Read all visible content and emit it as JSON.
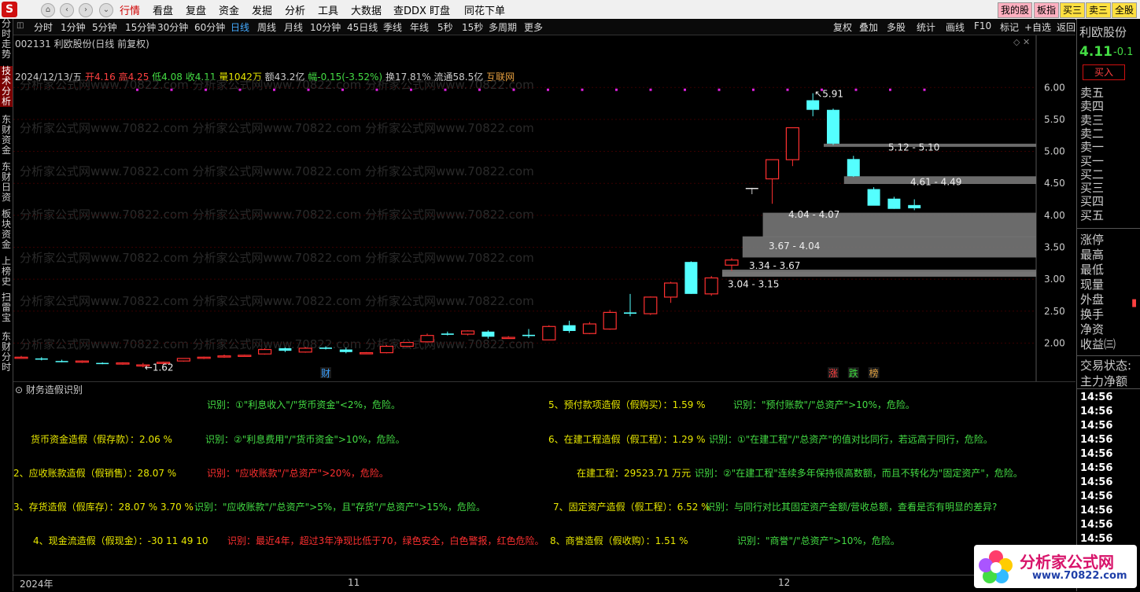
{
  "app": {
    "menus": [
      "行情",
      "看盘",
      "复盘",
      "资金",
      "发掘",
      "分析",
      "工具",
      "大数据",
      "查DDX",
      "盯盘",
      "同花下单"
    ],
    "active_menu": "行情",
    "right_buttons": [
      "我的股",
      "板指",
      "买三",
      "卖三",
      "全股"
    ]
  },
  "sidebar": {
    "tabs": [
      "分时走势",
      "技术分析",
      "东财资金",
      "东财日资",
      "板块资金",
      "上榜史",
      "扫雷宝",
      "东财分时"
    ],
    "active": "技术分析"
  },
  "period_bar": {
    "tabs": [
      "分时",
      "1分钟",
      "5分钟",
      "15分钟",
      "30分钟",
      "60分钟",
      "日线",
      "周线",
      "月线",
      "10分钟",
      "45日线",
      "季线",
      "年线",
      "5秒",
      "15秒",
      "多周期",
      "更多"
    ],
    "active": "日线",
    "tools": [
      "复权",
      "叠加",
      "多股",
      "统计",
      "画线",
      "F10",
      "标记",
      "+自选",
      "返回"
    ]
  },
  "stock": {
    "title": "002131 利欧股份(日线 前复权)",
    "date": "2024/12/13/五",
    "open": "开4.16",
    "high": "高4.25",
    "low": "低4.08",
    "close": "收4.11",
    "volume": "量1042万",
    "amount": "额43.2亿",
    "change": "幅-0.15(-3.52%)",
    "turnover": "换17.81%",
    "float_cap": "流通58.5亿",
    "concept": "互联网"
  },
  "watermark": "分析家公式网www.70822.com",
  "chart_data": {
    "type": "candlestick",
    "y_ticks": [
      "6.00",
      "5.50",
      "5.00",
      "4.50",
      "4.00",
      "3.50",
      "3.00",
      "2.50",
      "2.00"
    ],
    "ylim": [
      1.55,
      6.2
    ],
    "high_label": "5.91",
    "low_label": "1.62",
    "candles": [
      [
        1.78,
        1.8,
        1.76,
        1.78
      ],
      [
        1.76,
        1.78,
        1.73,
        1.75
      ],
      [
        1.72,
        1.74,
        1.7,
        1.71
      ],
      [
        1.71,
        1.73,
        1.69,
        1.72
      ],
      [
        1.69,
        1.7,
        1.67,
        1.68
      ],
      [
        1.68,
        1.7,
        1.66,
        1.69
      ],
      [
        1.66,
        1.69,
        1.62,
        1.66
      ],
      [
        1.69,
        1.71,
        1.67,
        1.7
      ],
      [
        1.72,
        1.76,
        1.71,
        1.76
      ],
      [
        1.77,
        1.79,
        1.75,
        1.78
      ],
      [
        1.79,
        1.82,
        1.77,
        1.8
      ],
      [
        1.8,
        1.82,
        1.79,
        1.81
      ],
      [
        1.83,
        1.92,
        1.82,
        1.9
      ],
      [
        1.92,
        1.93,
        1.86,
        1.88
      ],
      [
        1.86,
        1.94,
        1.85,
        1.92
      ],
      [
        1.93,
        1.95,
        1.9,
        1.91
      ],
      [
        1.9,
        1.93,
        1.84,
        1.86
      ],
      [
        1.84,
        1.86,
        1.83,
        1.85
      ],
      [
        1.85,
        1.97,
        1.84,
        1.95
      ],
      [
        1.95,
        2.02,
        1.94,
        2.01
      ],
      [
        2.02,
        2.15,
        2.01,
        2.12
      ],
      [
        2.15,
        2.18,
        2.12,
        2.13
      ],
      [
        2.14,
        2.2,
        2.12,
        2.19
      ],
      [
        2.18,
        2.2,
        2.07,
        2.1
      ],
      [
        2.09,
        2.11,
        2.07,
        2.09
      ],
      [
        2.13,
        2.22,
        2.08,
        2.11
      ],
      [
        2.05,
        2.28,
        2.05,
        2.26
      ],
      [
        2.28,
        2.35,
        2.16,
        2.19
      ],
      [
        2.15,
        2.33,
        2.14,
        2.3
      ],
      [
        2.22,
        2.52,
        2.21,
        2.48
      ],
      [
        2.48,
        2.77,
        2.42,
        2.46
      ],
      [
        2.46,
        2.73,
        2.44,
        2.72
      ],
      [
        2.72,
        2.96,
        2.63,
        2.94
      ],
      [
        3.27,
        3.28,
        2.77,
        2.77
      ],
      [
        2.77,
        3.05,
        2.74,
        3.02
      ],
      [
        3.22,
        3.33,
        3.13,
        3.3
      ],
      [
        4.42,
        4.43,
        4.33,
        4.42
      ],
      [
        4.57,
        4.87,
        4.18,
        4.87
      ],
      [
        4.87,
        5.37,
        4.77,
        5.37
      ],
      [
        5.8,
        5.91,
        5.55,
        5.65
      ],
      [
        5.65,
        5.67,
        5.1,
        5.12
      ],
      [
        4.88,
        4.93,
        4.6,
        4.61
      ],
      [
        4.41,
        4.44,
        4.18,
        4.15
      ],
      [
        4.26,
        4.29,
        4.1,
        4.1
      ],
      [
        4.16,
        4.25,
        4.08,
        4.11
      ]
    ],
    "volume_profile": [
      {
        "label": "5.12 - 5.10",
        "low": 5.1,
        "high": 5.12,
        "start": 40
      },
      {
        "label": "4.61 - 4.49",
        "low": 4.49,
        "high": 4.61,
        "start": 41
      },
      {
        "label": "4.04 - 4.07",
        "low": 3.66,
        "high": 4.04,
        "start": 37
      },
      {
        "label": "3.67 - 4.04",
        "low": 3.34,
        "high": 3.67,
        "start": 36
      },
      {
        "label": "3.34 - 3.67",
        "low": 3.04,
        "high": 3.12,
        "start": 35
      },
      {
        "label": "3.04 - 3.15",
        "low": 3.04,
        "high": 3.15,
        "start": 35
      }
    ],
    "markers": [
      {
        "text": "财",
        "index": 15,
        "color": "#3aa0ff"
      },
      {
        "text": "涨",
        "index": 40,
        "color": "#ff4040"
      },
      {
        "text": "跌",
        "index": 41,
        "color": "#40e040"
      },
      {
        "text": "榜",
        "index": 42,
        "color": "#e0a040"
      }
    ]
  },
  "lower": {
    "title": "财务造假识别",
    "rows": [
      {
        "x": 246,
        "y": 20,
        "cls": "g",
        "text": "识别：①\"利息收入\"/\"货币资金\"<2%，危险。"
      },
      {
        "x": 680,
        "y": 20,
        "cls": "y",
        "text": "5、预付款项造假（假购买）：1.59 %"
      },
      {
        "x": 915,
        "y": 20,
        "cls": "g",
        "text": "识别：\"预付账款\"/\"总资产\">10%，危险。"
      },
      {
        "x": 22,
        "y": 64,
        "cls": "y",
        "text": "货币资金造假（假存款）：2.06 %"
      },
      {
        "x": 244,
        "y": 64,
        "cls": "g",
        "text": "识别：②\"利息费用\"/\"货币资金\">10%，危险。"
      },
      {
        "x": 680,
        "y": 64,
        "cls": "y",
        "text": "6、在建工程造假（假工程）：1.29 %"
      },
      {
        "x": 884,
        "y": 64,
        "cls": "g",
        "text": "识别：①\"在建工程\"/\"总资产\"的值对比同行，若远高于同行，危险。"
      },
      {
        "x": 0,
        "y": 107,
        "cls": "y",
        "text": "2、应收账款造假（假销售）：28.07 %"
      },
      {
        "x": 246,
        "y": 107,
        "cls": "r",
        "text": "识别：\"应收账款\"/\"总资产\">20%，危险。"
      },
      {
        "x": 716,
        "y": 107,
        "cls": "y",
        "text": "在建工程：29523.71 万元"
      },
      {
        "x": 866,
        "y": 107,
        "cls": "g",
        "text": "识别：②\"在建工程\"连续多年保持很高数额，而且不转化为\"固定资产\"，危险。"
      },
      {
        "x": 0,
        "y": 150,
        "cls": "y",
        "text": "3、存货造假（假库存）：28.07 %  3.70 %"
      },
      {
        "x": 230,
        "y": 150,
        "cls": "g",
        "text": "识别：\"应收账款\"/\"总资产\">5%，且\"存货\"/\"总资产\">15%，危险。"
      },
      {
        "x": 686,
        "y": 150,
        "cls": "y",
        "text": "7、固定资产造假（假工程）：6.52 %"
      },
      {
        "x": 880,
        "y": 150,
        "cls": "g",
        "text": "识别：与同行对比其固定资产金额/营收总额，查看是否有明显的差异?"
      },
      {
        "x": 25,
        "y": 193,
        "cls": "y",
        "text": "4、现金流造假（假现金）：-30 11 49 10"
      },
      {
        "x": 272,
        "y": 193,
        "cls": "r",
        "text": "识别：最近4年，超过3年净现比低于70，绿色安全，白色警报，红色危险。"
      },
      {
        "x": 682,
        "y": 193,
        "cls": "y",
        "text": "8、商誉造假（假收购）：1.51 %"
      },
      {
        "x": 920,
        "y": 193,
        "cls": "g",
        "text": "识别：\"商誉\"/\"总资产\">10%，危险。"
      }
    ]
  },
  "date_axis": [
    "2024年",
    "11",
    "12"
  ],
  "right_panel": {
    "name": "利欧股份",
    "price": "4.11",
    "change": "-0.1",
    "buy_button": "买入",
    "book": [
      "卖五",
      "卖四",
      "卖三",
      "卖二",
      "卖一",
      "买一",
      "买二",
      "买三",
      "买四",
      "买五"
    ],
    "stats": [
      "涨停",
      "最高",
      "最低",
      "现量",
      "外盘",
      "换手",
      "净资",
      "收益㈢"
    ],
    "trade_status": "交易状态:",
    "main_flow": "主力净额",
    "times": [
      "14:56",
      "14:56",
      "14:56",
      "14:56",
      "14:56",
      "14:56",
      "14:56",
      "14:56",
      "14:56",
      "14:56",
      "14:56"
    ]
  },
  "brand": {
    "name": "分析家公式网",
    "url": "www.70822.com"
  },
  "colors": {
    "up": "#ff3030",
    "down": "#54ffff",
    "purple": "#e020e0",
    "accent": "#d01010"
  }
}
